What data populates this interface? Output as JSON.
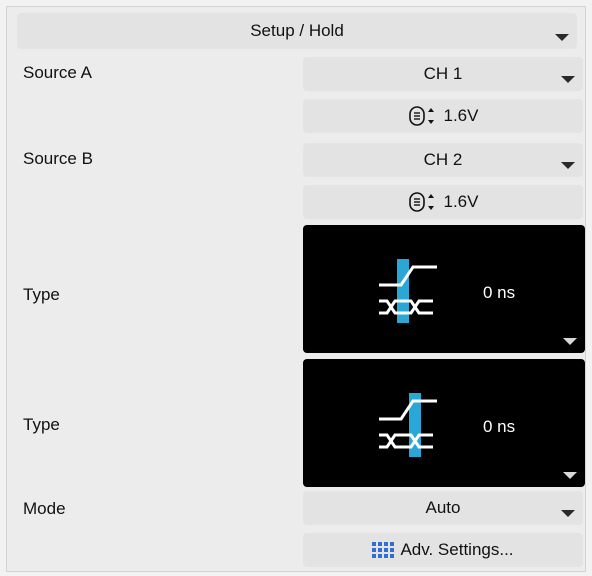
{
  "header": {
    "title": "Setup / Hold"
  },
  "source_a": {
    "label": "Source A",
    "channel": "CH 1",
    "threshold": "1.6V"
  },
  "source_b": {
    "label": "Source B",
    "channel": "CH 2",
    "threshold": "1.6V"
  },
  "type1": {
    "label": "Type",
    "value": "0 ns"
  },
  "type2": {
    "label": "Type",
    "value": "0 ns"
  },
  "mode": {
    "label": "Mode",
    "value": "Auto"
  },
  "adv_settings": {
    "label": "Adv. Settings..."
  },
  "colors": {
    "accent": "#2aa7d6",
    "wave": "#ffffff",
    "panel": "#e3e3e3"
  },
  "icons": {
    "threshold": "threshold-level-icon",
    "adv": "grid-icon",
    "dropdown": "chevron-down-icon"
  }
}
